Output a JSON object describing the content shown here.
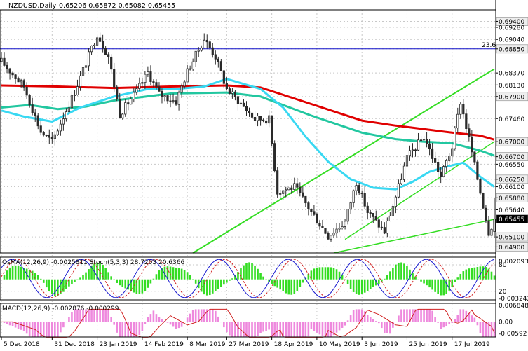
{
  "header": {
    "symbol": "NZDUSD,Daily",
    "ohlc": "0.65206 0.65872 0.65082 0.65455"
  },
  "colors": {
    "background": "#ffffff",
    "grid": "#c8c8c8",
    "bull_candle": "#2a2a2a",
    "bear_candle": "#2a2a2a",
    "ema200": "#e00000",
    "ema144": "#22c7a0",
    "ema50": "#39d8f2",
    "channel": "#33dd22",
    "level_line": "#1010c8",
    "histogram_pos": "#33dd22",
    "histogram_neg": "#33dd22",
    "stoch_main": "#1a1ad0",
    "stoch_signal": "#d02020",
    "macd_hist": "#ee88dd",
    "macd_signal": "#d02020",
    "price_tag_current": "#000000"
  },
  "chart_data": {
    "type": "candlestick",
    "instrument": "NZDUSD",
    "timeframe": "Daily",
    "last_bar": {
      "open": 0.65206,
      "high": 0.65872,
      "low": 0.65082,
      "close": 0.65455
    },
    "price_axis": {
      "ylim": [
        0.6478,
        0.6963
      ],
      "ticks": [
        "0.69400",
        "0.69280",
        "0.69040",
        "0.68850",
        "0.68370",
        "0.68130",
        "0.67900",
        "0.67460",
        "0.67000",
        "0.66700",
        "0.66550",
        "0.66250",
        "0.66100",
        "0.65880",
        "0.65640",
        "0.65455",
        "0.65100",
        "0.64900"
      ]
    },
    "highlighted_levels": [
      "0.69400",
      "0.68850",
      "0.67900",
      "0.67000",
      "0.66700",
      "0.66250",
      "0.65880",
      "0.65100",
      "0.64900"
    ],
    "current_price": "0.65455",
    "fib_label": "23.6",
    "fib_level": 0.6885,
    "date_labels": [
      "5 Dec 2018",
      "31 Dec 2018",
      "23 Jan 2019",
      "14 Feb 2019",
      "8 Mar 2019",
      "27 Mar 2019",
      "18 Apr 2019",
      "10 May 2019",
      "3 Jun 2019",
      "25 Jun 2019",
      "17 Jul 2019"
    ],
    "date_label_bars": [
      0,
      18,
      34,
      50,
      66,
      80,
      96,
      112,
      128,
      144,
      160
    ],
    "bars": 176,
    "candles": [],
    "moving_averages": [
      {
        "name": "EMA200",
        "color": "#e00000",
        "points": [
          [
            0,
            0.6812
          ],
          [
            20,
            0.681
          ],
          [
            40,
            0.6807
          ],
          [
            60,
            0.681
          ],
          [
            80,
            0.6812
          ],
          [
            92,
            0.6808
          ],
          [
            110,
            0.6775
          ],
          [
            128,
            0.6742
          ],
          [
            140,
            0.6732
          ],
          [
            150,
            0.6725
          ],
          [
            160,
            0.6718
          ],
          [
            170,
            0.6712
          ],
          [
            175,
            0.6704
          ]
        ]
      },
      {
        "name": "EMA144",
        "color": "#22c7a0",
        "points": [
          [
            0,
            0.6768
          ],
          [
            10,
            0.6773
          ],
          [
            20,
            0.6765
          ],
          [
            30,
            0.677
          ],
          [
            40,
            0.6782
          ],
          [
            60,
            0.6796
          ],
          [
            80,
            0.6798
          ],
          [
            92,
            0.679
          ],
          [
            110,
            0.6752
          ],
          [
            128,
            0.6718
          ],
          [
            140,
            0.6705
          ],
          [
            150,
            0.67
          ],
          [
            160,
            0.6697
          ],
          [
            170,
            0.6682
          ],
          [
            175,
            0.6672
          ]
        ]
      },
      {
        "name": "EMA50",
        "color": "#39d8f2",
        "points": [
          [
            0,
            0.6762
          ],
          [
            8,
            0.675
          ],
          [
            18,
            0.674
          ],
          [
            28,
            0.6768
          ],
          [
            40,
            0.679
          ],
          [
            52,
            0.6805
          ],
          [
            62,
            0.6805
          ],
          [
            72,
            0.681
          ],
          [
            80,
            0.6825
          ],
          [
            92,
            0.6805
          ],
          [
            100,
            0.6768
          ],
          [
            108,
            0.671
          ],
          [
            116,
            0.666
          ],
          [
            124,
            0.6625
          ],
          [
            132,
            0.6608
          ],
          [
            140,
            0.6605
          ],
          [
            146,
            0.662
          ],
          [
            152,
            0.664
          ],
          [
            158,
            0.665
          ],
          [
            164,
            0.6658
          ],
          [
            170,
            0.663
          ],
          [
            175,
            0.661
          ]
        ]
      }
    ],
    "channel_lines": [
      {
        "from": [
          68,
          0.6478
        ],
        "to": [
          175,
          0.6845
        ]
      },
      {
        "from": [
          118,
          0.6478
        ],
        "to": [
          175,
          0.6545
        ]
      },
      {
        "from": [
          122,
          0.6505
        ],
        "to": [
          175,
          0.67
        ]
      }
    ],
    "oscillator_panel": {
      "label": "OsMA(12,26,9) -0.0025811  Stoch(5,3,3) 28.7203 20.6366",
      "right_ticks": [
        "80",
        "20",
        "0.002093",
        "-0.003242"
      ],
      "stoch_levels": [
        80,
        20
      ],
      "osma": [],
      "stoch_main": [],
      "stoch_signal": []
    },
    "macd_panel": {
      "label": "MACD(12,26,9) -0.002876 -0.000299",
      "right_ticks": [
        "0.006848",
        "0.00",
        "-0.00592"
      ],
      "hist": [],
      "signal": []
    }
  }
}
